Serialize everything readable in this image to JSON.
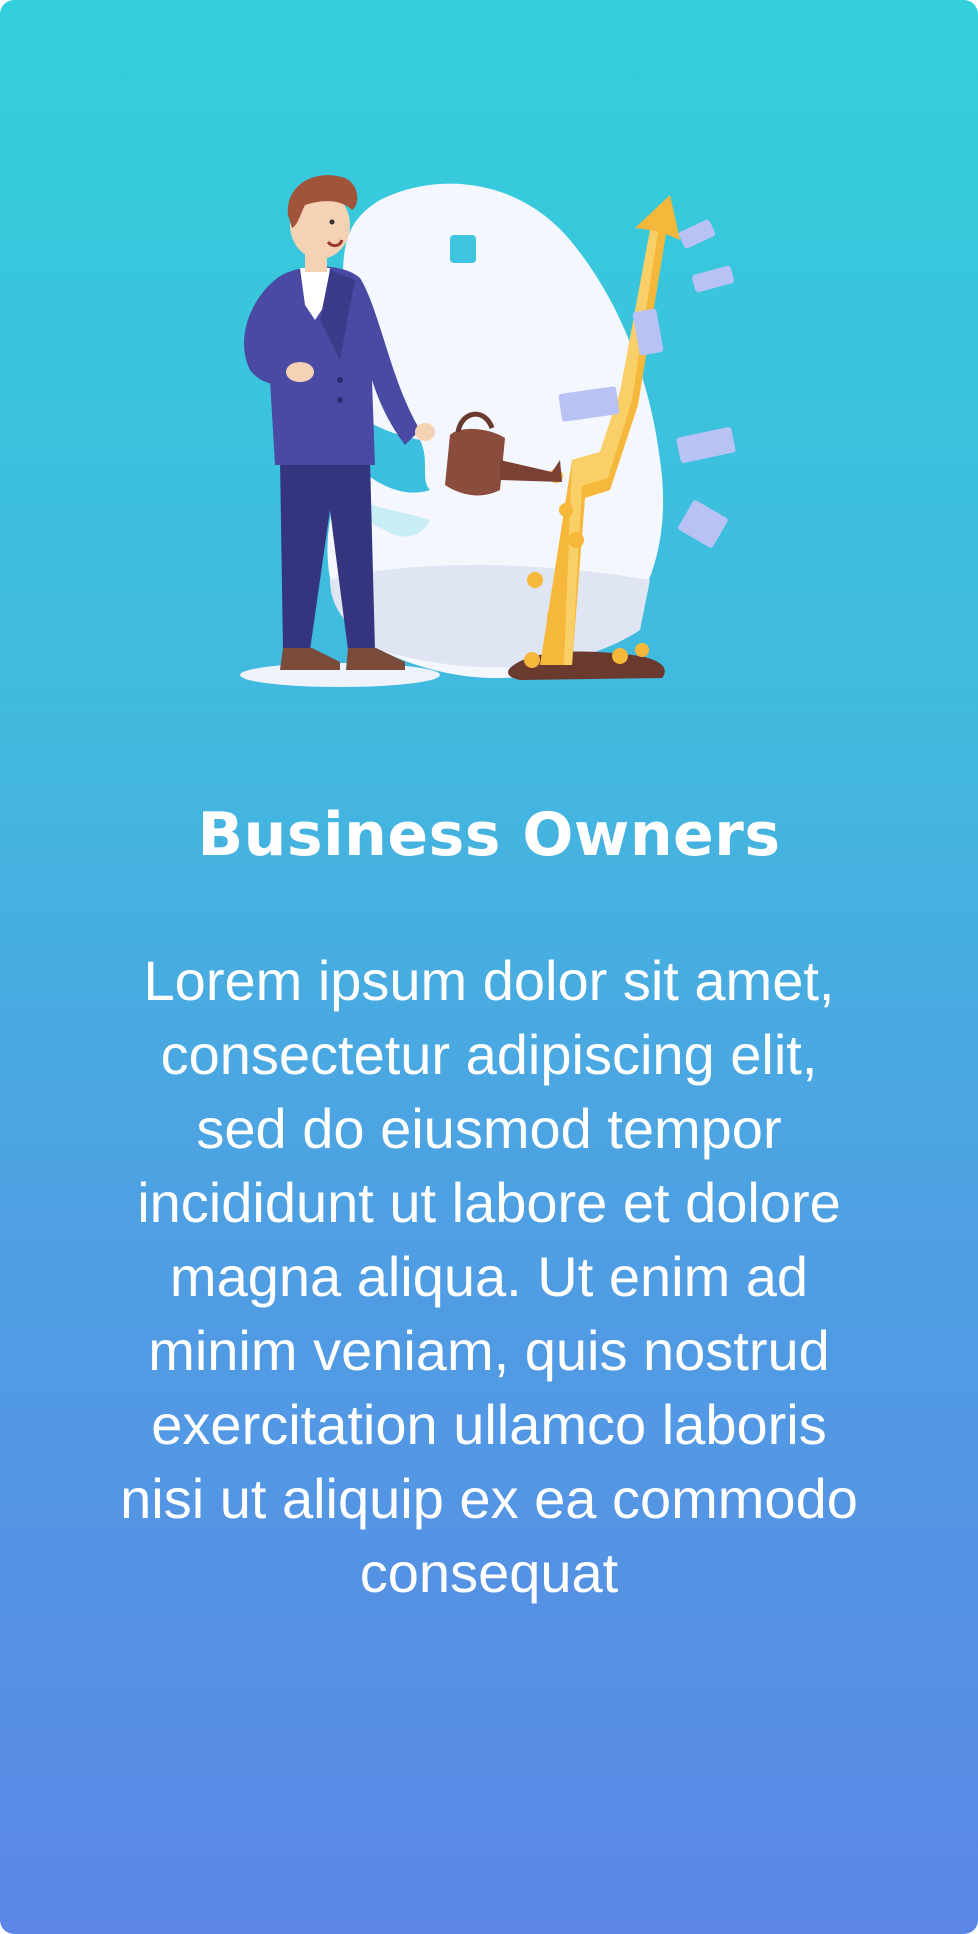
{
  "card": {
    "title": "Business Owners",
    "description": "Lorem ipsum dolor sit amet, consectetur adipiscing elit, sed do eiusmod tempor incididunt ut labore et dolore magna aliqua. Ut enim ad minim veniam, quis nostrud exercitation ullamco laboris nisi ut aliquip ex ea commodo consequat"
  },
  "illustration": {
    "subject": "business-owner-watering-growth-icon"
  },
  "colors": {
    "gradient_top": "#33cfdb",
    "gradient_bottom": "#5b86e6",
    "suit": "#3f3f96",
    "arrow": "#f6b83a",
    "money": "#b9c2f5",
    "blob": "#f4f7fd"
  }
}
